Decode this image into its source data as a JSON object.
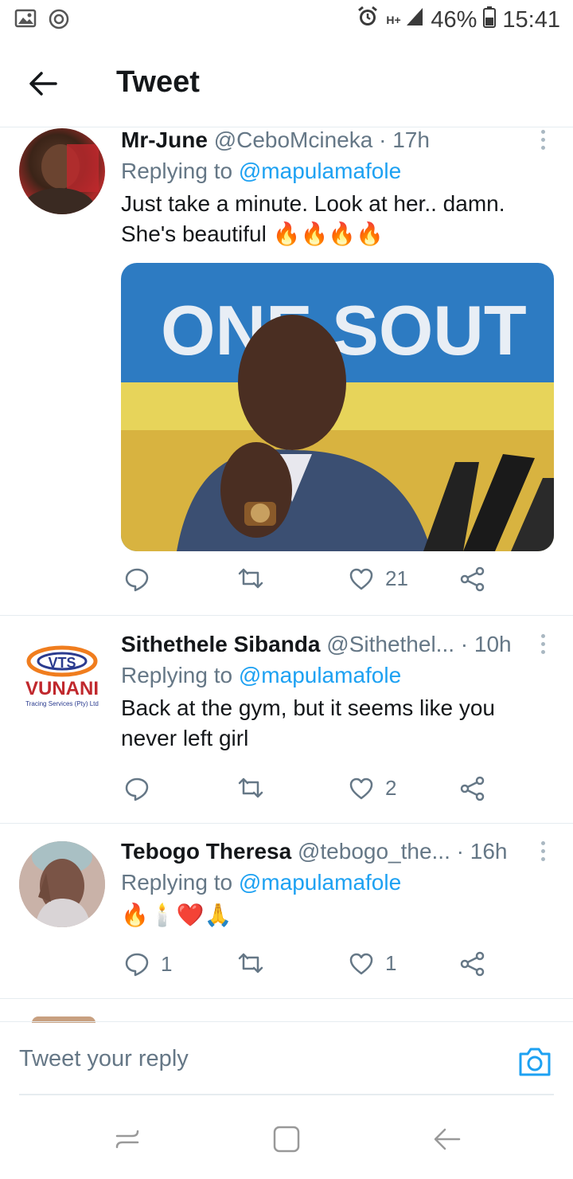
{
  "status_bar": {
    "battery": "46%",
    "time": "15:41",
    "network": "H+"
  },
  "header": {
    "title": "Tweet"
  },
  "tweets": [
    {
      "name": "Mr-June",
      "handle": "@CeboMcineka",
      "time": "· 17h",
      "replying_prefix": "Replying to ",
      "replying_to": "@mapulamafole",
      "text": "Just take a minute. Look at her.. damn. She's beautiful 🔥🔥🔥🔥",
      "replies": "",
      "likes": "21",
      "media_text": "ONE SOUT"
    },
    {
      "name": "Sithethele Sibanda",
      "handle": "@Sithethel...",
      "time": "· 10h",
      "replying_prefix": "Replying to ",
      "replying_to": "@mapulamafole",
      "text": "Back at the gym, but it seems like you never left girl",
      "replies": "",
      "likes": "2",
      "avatar_logo": "VTS",
      "avatar_brand": "VUNANI",
      "avatar_sub": "Tracing Services (Pty) Ltd"
    },
    {
      "name": "Tebogo Theresa",
      "handle": "@tebogo_the...",
      "time": "· 16h",
      "replying_prefix": "Replying to ",
      "replying_to": "@mapulamafole",
      "text": "🔥🕯️❤️🙏",
      "replies": "1",
      "likes": "1"
    }
  ],
  "reply_box": {
    "placeholder": "Tweet your reply"
  },
  "colors": {
    "accent": "#1da1f2",
    "secondary_text": "#657786"
  }
}
